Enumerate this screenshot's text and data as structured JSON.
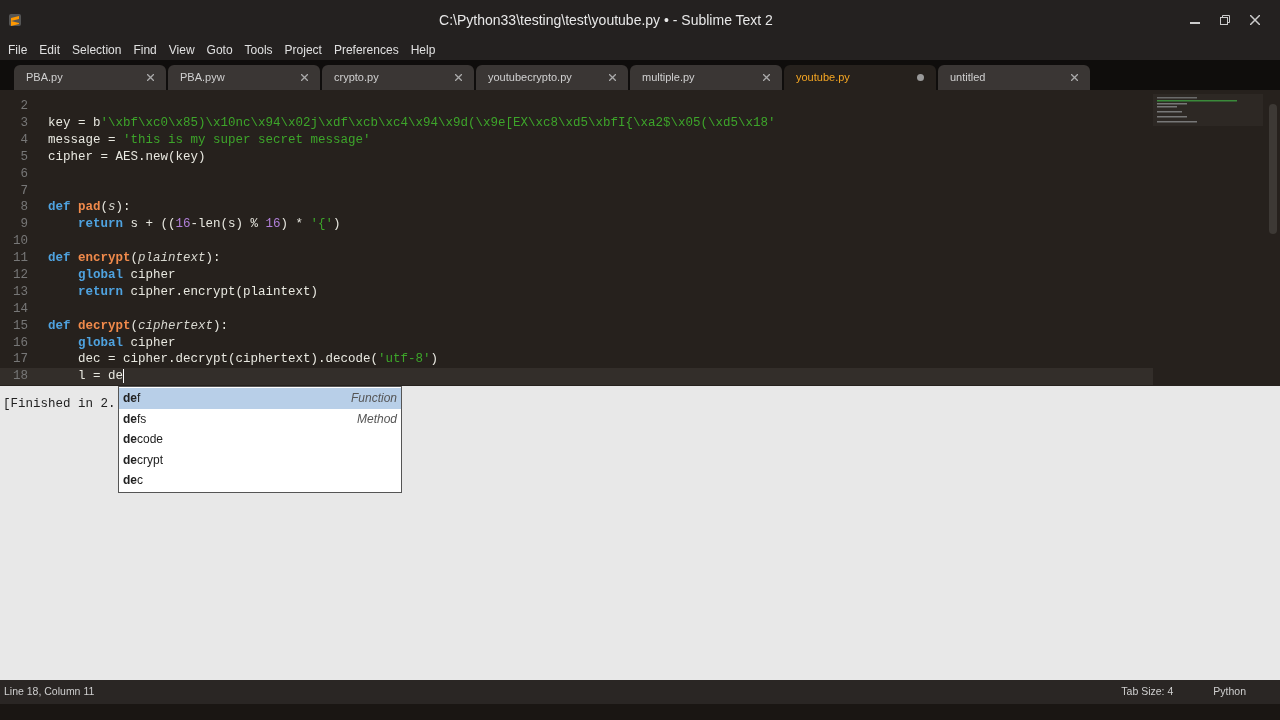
{
  "window": {
    "title": "C:\\Python33\\testing\\test\\youtube.py • - Sublime Text 2"
  },
  "menu": [
    "File",
    "Edit",
    "Selection",
    "Find",
    "View",
    "Goto",
    "Tools",
    "Project",
    "Preferences",
    "Help"
  ],
  "tabs": [
    {
      "label": "PBA.py",
      "selected": false,
      "modified": false
    },
    {
      "label": "PBA.pyw",
      "selected": false,
      "modified": false
    },
    {
      "label": "crypto.py",
      "selected": false,
      "modified": false
    },
    {
      "label": "youtubecrypto.py",
      "selected": false,
      "modified": false
    },
    {
      "label": "multiple.py",
      "selected": false,
      "modified": false
    },
    {
      "label": "youtube.py",
      "selected": true,
      "modified": true
    },
    {
      "label": "untitled",
      "selected": false,
      "modified": false
    }
  ],
  "editor": {
    "lines": [
      {
        "number": "2"
      },
      {
        "number": "3",
        "tokens": [
          {
            "kind": "plain",
            "text": "key = b"
          },
          {
            "kind": "string",
            "text": "'\\xbf\\xc0\\x85)\\x10nc\\x94\\x02j\\xdf\\xcb\\xc4\\x94\\x9d(\\x9e[EX\\xc8\\xd5\\xbfI{\\xa2$\\x05(\\xd5\\x18'"
          }
        ]
      },
      {
        "number": "4",
        "tokens": [
          {
            "kind": "plain",
            "text": "message = "
          },
          {
            "kind": "string",
            "text": "'this is my super secret message'"
          }
        ]
      },
      {
        "number": "5",
        "tokens": [
          {
            "kind": "plain",
            "text": "cipher = AES.new(key)"
          }
        ]
      },
      {
        "number": "6"
      },
      {
        "number": "7"
      },
      {
        "number": "8",
        "tokens": [
          {
            "kind": "keyword",
            "text": "def "
          },
          {
            "kind": "function",
            "text": "pad"
          },
          {
            "kind": "plain",
            "text": "("
          },
          {
            "kind": "param",
            "text": "s"
          },
          {
            "kind": "plain",
            "text": "):"
          }
        ]
      },
      {
        "number": "9",
        "tokens": [
          {
            "kind": "keyword",
            "text": "    return"
          },
          {
            "kind": "plain",
            "text": " s + (("
          },
          {
            "kind": "number",
            "text": "16"
          },
          {
            "kind": "plain",
            "text": "-len(s) % "
          },
          {
            "kind": "number",
            "text": "16"
          },
          {
            "kind": "plain",
            "text": ") * "
          },
          {
            "kind": "string",
            "text": "'{'"
          },
          {
            "kind": "plain",
            "text": ")"
          }
        ]
      },
      {
        "number": "10"
      },
      {
        "number": "11",
        "tokens": [
          {
            "kind": "keyword",
            "text": "def "
          },
          {
            "kind": "function",
            "text": "encrypt"
          },
          {
            "kind": "plain",
            "text": "("
          },
          {
            "kind": "param",
            "text": "plaintext"
          },
          {
            "kind": "plain",
            "text": "):"
          }
        ]
      },
      {
        "number": "12",
        "tokens": [
          {
            "kind": "keyword",
            "text": "    global"
          },
          {
            "kind": "plain",
            "text": " cipher"
          }
        ]
      },
      {
        "number": "13",
        "tokens": [
          {
            "kind": "keyword",
            "text": "    return"
          },
          {
            "kind": "plain",
            "text": " cipher.encrypt(plaintext)"
          }
        ]
      },
      {
        "number": "14"
      },
      {
        "number": "15",
        "tokens": [
          {
            "kind": "keyword",
            "text": "def "
          },
          {
            "kind": "function",
            "text": "decrypt"
          },
          {
            "kind": "plain",
            "text": "("
          },
          {
            "kind": "param",
            "text": "ciphertext"
          },
          {
            "kind": "plain",
            "text": "):"
          }
        ]
      },
      {
        "number": "16",
        "tokens": [
          {
            "kind": "keyword",
            "text": "    global"
          },
          {
            "kind": "plain",
            "text": " cipher"
          }
        ]
      },
      {
        "number": "17",
        "tokens": [
          {
            "kind": "plain",
            "text": "    dec = cipher.decrypt(ciphertext).decode("
          },
          {
            "kind": "string",
            "text": "'utf-8'"
          },
          {
            "kind": "plain",
            "text": ")"
          }
        ]
      },
      {
        "number": "18",
        "tokens": [
          {
            "kind": "plain",
            "text": "    l = de"
          }
        ],
        "current": true
      }
    ]
  },
  "autocomplete": [
    {
      "text": "**de**f",
      "hint": "Function",
      "selected": true
    },
    {
      "text": "**de**fs",
      "hint": "Method",
      "selected": false
    },
    {
      "text": "**de**code",
      "selected": false
    },
    {
      "text": "**de**crypt",
      "selected": false
    },
    {
      "text": "**de**c",
      "selected": false
    }
  ],
  "output": {
    "text": "[Finished in 2."
  },
  "status_bar": {
    "position": "Line 18, Column 11",
    "tab_size": "Tab Size: 4",
    "syntax": "Python"
  }
}
